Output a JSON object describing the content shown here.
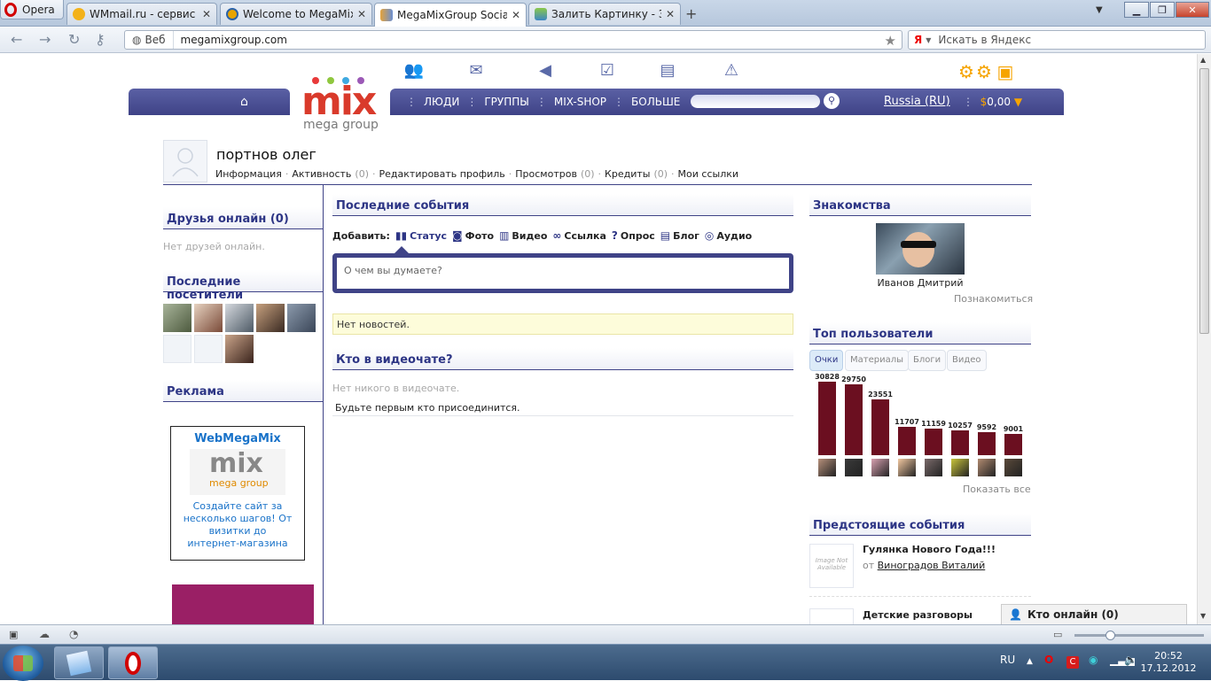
{
  "browser": {
    "menu_label": "Opera",
    "tabs": [
      {
        "label": "WMmail.ru - сервис п...",
        "close": "✕"
      },
      {
        "label": "Welcome to MegaMix...",
        "close": "✕"
      },
      {
        "label": "MegaMixGroup Social ...",
        "close": "✕"
      },
      {
        "label": "Залить Картинку - Заг...",
        "close": "✕"
      }
    ],
    "web_label": "Веб",
    "url": "megamixgroup.com",
    "search_engine_icon": "Я",
    "search_placeholder": "Искать в Яндекс"
  },
  "site": {
    "logo_text": "mix",
    "logo_sub": "mega group",
    "menu": [
      "ЛЮДИ",
      "ГРУППЫ",
      "MIX-SHOP",
      "БОЛЬШЕ"
    ],
    "language": "Russia (RU)",
    "cart_currency": "$",
    "cart_amount": "0,00"
  },
  "profile": {
    "name": "портнов олег",
    "links": [
      {
        "label": "Информация",
        "count": ""
      },
      {
        "label": "Активность",
        "count": "(0)"
      },
      {
        "label": "Редактировать профиль",
        "count": ""
      },
      {
        "label": "Просмотров",
        "count": "(0)"
      },
      {
        "label": "Кредиты",
        "count": "(0)"
      },
      {
        "label": "Мои ссылки",
        "count": ""
      }
    ]
  },
  "left": {
    "friends_title": "Друзья онлайн (0)",
    "friends_empty": "Нет друзей онлайн.",
    "visitors_title": "Последние посетители",
    "ads_title": "Реклама",
    "ad": {
      "title": "WebMegaMix",
      "logo_text": "mix",
      "logo_sub": "mega group",
      "text": "Создайте сайт за несколько шагов! От визитки до интернет-магазина"
    }
  },
  "center": {
    "events_title": "Последние события",
    "add_label": "Добавить:",
    "add_options": [
      "Статус",
      "Фото",
      "Видео",
      "Ссылка",
      "Опрос",
      "Блог",
      "Аудио"
    ],
    "status_placeholder": "О чем вы думаете?",
    "no_news": "Нет новостей.",
    "videochat_title": "Кто в видеочате?",
    "videochat_empty": "Нет никого в видеочате.",
    "videochat_join": "Будьте первым кто присоединится."
  },
  "right": {
    "dating_title": "Знакомства",
    "dating_name": "Иванов Дмитрий",
    "dating_action": "Познакомиться",
    "top_title": "Топ пользователи",
    "top_tabs": [
      "Очки",
      "Материалы",
      "Блоги",
      "Видео"
    ],
    "top_values": [
      30828,
      29750,
      23551,
      11707,
      11159,
      10257,
      9592,
      9001
    ],
    "show_all": "Показать все",
    "events_title": "Предстоящие события",
    "event1_title": "Гулянка Нового Года!!!",
    "event1_from": "от",
    "event1_author": "Виноградов Виталий",
    "event_img": "Image Not Available",
    "event2_title": "Детские разговоры"
  },
  "online_bar": "Кто онлайн (0)",
  "taskbar": {
    "lang": "RU",
    "time": "20:52",
    "date": "17.12.2012"
  },
  "colors": {
    "brand": "#3f4387",
    "bar": "#6b0f20",
    "accent": "#f6a400"
  }
}
